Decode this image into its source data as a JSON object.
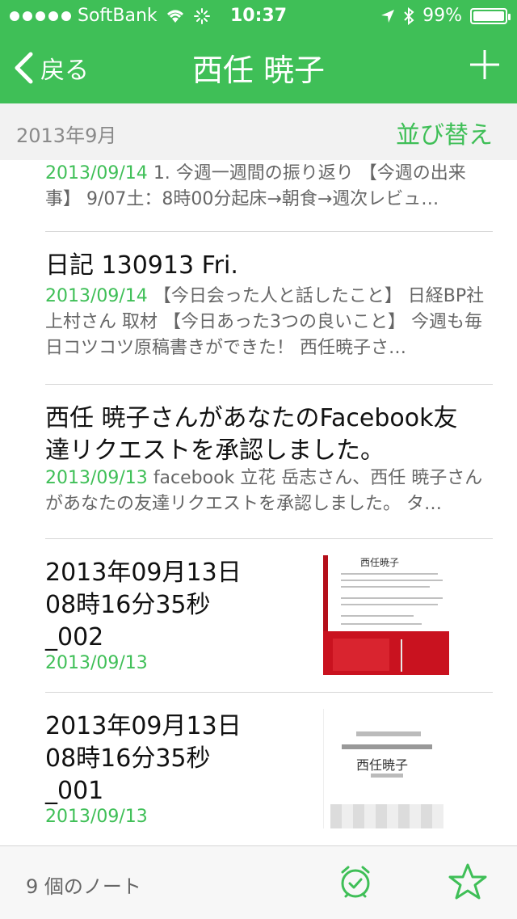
{
  "status_bar": {
    "carrier": "SoftBank",
    "time": "10:37",
    "battery": "99%"
  },
  "nav": {
    "back_label": "戻る",
    "title": "西任 暁子"
  },
  "section": {
    "month": "2013年9月",
    "sort_label": "並び替え"
  },
  "notes": [
    {
      "title": "",
      "date": "2013/09/14",
      "snippet": "1. 今週一週間の振り返り 【今週の出来事】 9/07土：8時00分起床→朝食→週次レビュ…"
    },
    {
      "title": "日記 130913 Fri.",
      "date": "2013/09/14",
      "snippet": "【今日会った人と話したこと】 日経BP社 上村さん 取材 【今日あった3つの良いこと】 今週も毎日コツコツ原稿書きができた！ 西任暁子さ…"
    },
    {
      "title": "西任 暁子さんがあなたのFacebook友\n達リクエストを承認しました。",
      "date": "2013/09/13",
      "snippet": "facebook 立花 岳志さん、西任 暁子さんがあなたの友達リクエストを承認しました。 タ…"
    },
    {
      "title": "2013年09月13日\n08時16分35秒\n_002",
      "date": "2013/09/13",
      "snippet": ""
    },
    {
      "title": "2013年09月13日\n08時16分35秒\n_001",
      "date": "2013/09/13",
      "snippet": ""
    }
  ],
  "thumbs": {
    "card1_name": "西任暁子",
    "card2_name": "西任暁子"
  },
  "toolbar": {
    "count": "9 個のノート"
  },
  "colors": {
    "accent": "#3fbf57",
    "header_bg": "#3fbf57"
  }
}
